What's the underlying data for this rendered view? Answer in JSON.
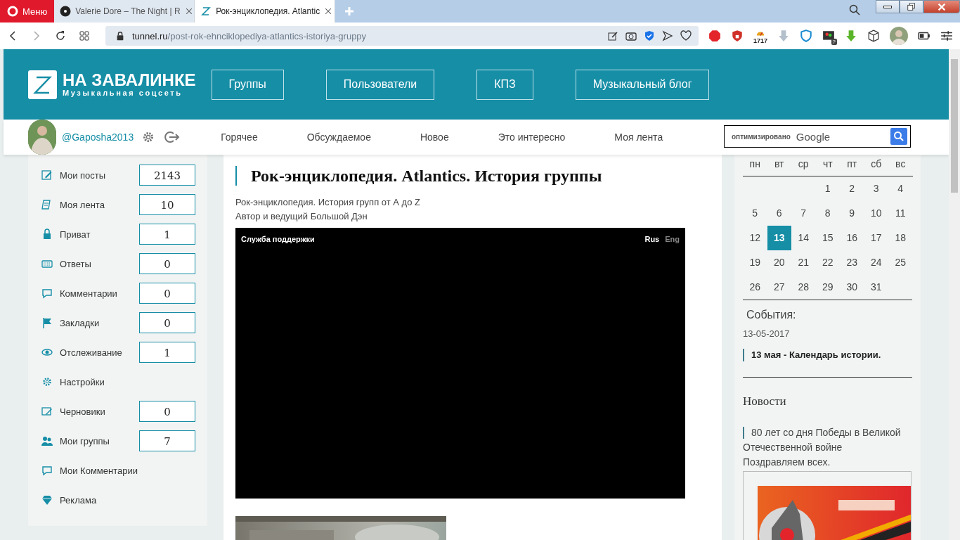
{
  "browser": {
    "menu_label": "Меню",
    "tabs": [
      {
        "title": "Valerie Dore – The Night | R",
        "selected": false,
        "kind": "disc"
      },
      {
        "title": "Рок-энциклопедия. Atlantic",
        "selected": true,
        "kind": "site"
      }
    ],
    "address": {
      "domain": "tunnel.ru",
      "path": "/post-rok-ehnciklopediya-atlantics-istoriya-gruppy"
    },
    "extension_count": "1717",
    "extension_badge": "?"
  },
  "site": {
    "logo": {
      "title": "НА ЗАВАЛИНКЕ",
      "subtitle": "Музыкальная соцсеть"
    },
    "nav_buttons": [
      "Группы",
      "Пользователи",
      "КПЗ",
      "Музыкальный блог"
    ],
    "user": {
      "handle": "@Gaposha2013"
    },
    "sub_nav": [
      "Горячее",
      "Обсуждаемое",
      "Новое",
      "Это интересно",
      "Моя лента"
    ],
    "search": {
      "label": "оптимизировано",
      "brand": "Google"
    }
  },
  "sidebar": {
    "items": [
      {
        "label": "Мои посты",
        "count": "2143"
      },
      {
        "label": "Моя лента",
        "count": "10"
      },
      {
        "label": "Приват",
        "count": "1"
      },
      {
        "label": "Ответы",
        "count": "0"
      },
      {
        "label": "Комментарии",
        "count": "0"
      },
      {
        "label": "Закладки",
        "count": "0"
      },
      {
        "label": "Отслеживание",
        "count": "1"
      },
      {
        "label": "Настройки"
      },
      {
        "label": "Черновики",
        "count": "0"
      },
      {
        "label": "Мои группы",
        "count": "7"
      },
      {
        "label": "Мои Комментарии"
      },
      {
        "label": "Реклама"
      }
    ]
  },
  "article": {
    "title": "Рок-энциклопедия. Atlantics. История группы",
    "lines": [
      "Рок-энциклопедия. История групп от А до Z",
      "Автор и ведущий Большой Дэн"
    ],
    "video": {
      "title": "Служба поддержки",
      "languages": [
        {
          "label": "Rus",
          "selected": true
        },
        {
          "label": "Eng",
          "selected": false
        }
      ]
    }
  },
  "calendar": {
    "weekdays": [
      "пн",
      "вт",
      "ср",
      "чт",
      "пт",
      "сб",
      "вс"
    ],
    "weeks": [
      [
        {
          "day": "1",
          "selected": false
        },
        {
          "day": "2",
          "selected": false
        },
        {
          "day": "3",
          "selected": false
        },
        {
          "day": "4",
          "selected": false
        }
      ],
      [
        {
          "day": "5",
          "selected": false
        },
        {
          "day": "6",
          "selected": false
        },
        {
          "day": "7",
          "selected": false
        },
        {
          "day": "8",
          "selected": false
        },
        {
          "day": "9",
          "selected": false
        },
        {
          "day": "10",
          "selected": false
        },
        {
          "day": "11",
          "selected": false
        }
      ],
      [
        {
          "day": "12",
          "selected": false
        },
        {
          "day": "13",
          "selected": true
        },
        {
          "day": "14",
          "selected": false
        },
        {
          "day": "15",
          "selected": false
        },
        {
          "day": "16",
          "selected": false
        },
        {
          "day": "17",
          "selected": false
        },
        {
          "day": "18",
          "selected": false
        }
      ],
      [
        {
          "day": "19",
          "selected": false
        },
        {
          "day": "20",
          "selected": false
        },
        {
          "day": "21",
          "selected": false
        },
        {
          "day": "22",
          "selected": false
        },
        {
          "day": "23",
          "selected": false
        },
        {
          "day": "24",
          "selected": false
        },
        {
          "day": "25",
          "selected": false
        }
      ],
      [
        {
          "day": "26",
          "selected": false
        },
        {
          "day": "27",
          "selected": false
        },
        {
          "day": "28",
          "selected": false
        },
        {
          "day": "29",
          "selected": false
        },
        {
          "day": "30",
          "selected": false
        },
        {
          "day": "31",
          "selected": false
        }
      ]
    ]
  },
  "events": {
    "heading": "События:",
    "date": "13-05-2017",
    "items": [
      "13 мая - Календарь истории."
    ]
  },
  "news": {
    "heading": "Новости",
    "items": [
      {
        "title": "80 лет со дня Победы в Великой Отечественной войне",
        "text": "Поздравляем всех."
      }
    ]
  }
}
